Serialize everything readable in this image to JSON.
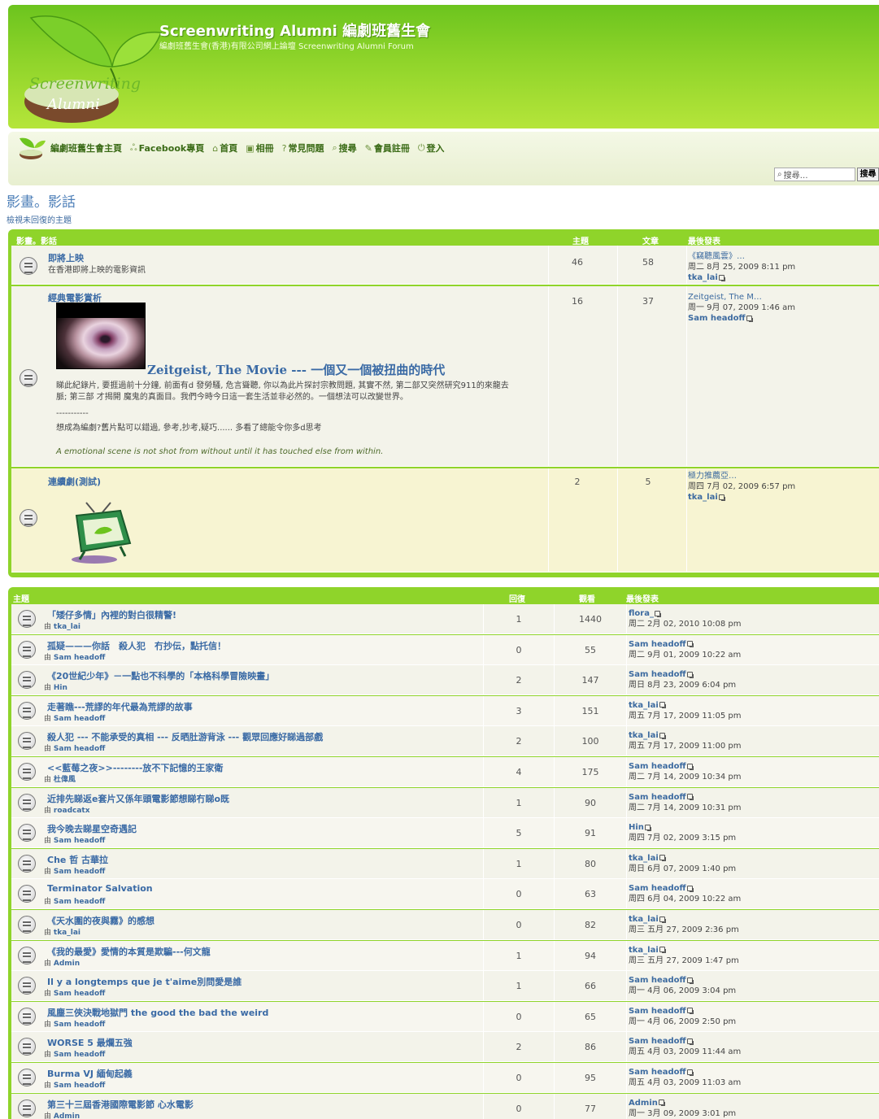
{
  "site": {
    "title": "Screenwriting Alumni 編劇班舊生會",
    "description": "編劇班舊生會(香港)有限公司網上論壇 Screenwriting Alumni Forum",
    "logo_text_1": "Screenwriting",
    "logo_text_2": "Alumni"
  },
  "nav": {
    "items": [
      {
        "icon": "home-icon",
        "label": "編劇班舊生會主頁"
      },
      {
        "icon": "facebook-icon",
        "label": "Facebook專頁"
      },
      {
        "icon": "house-icon",
        "label": "首頁"
      },
      {
        "icon": "album-icon",
        "label": "相冊"
      },
      {
        "icon": "faq-icon",
        "label": "常見問題"
      },
      {
        "icon": "search-icon",
        "label": "搜尋"
      },
      {
        "icon": "register-icon",
        "label": "會員註冊"
      },
      {
        "icon": "login-icon",
        "label": "登入"
      }
    ],
    "search_placeholder": "搜尋…",
    "search_button": "搜尋"
  },
  "page": {
    "title": "影畫。影話",
    "unanswered_link": "檢視未回復的主題"
  },
  "forums": {
    "header": {
      "name": "影畫。影話",
      "topics": "主題",
      "posts": "文章",
      "last_post": "最後發表"
    },
    "rows": [
      {
        "title": "即將上映",
        "desc": "在香港即將上映的電影資訊",
        "topics": "46",
        "posts": "58",
        "last_title": "《竊聽風雲》…",
        "last_date": "周二 8月 25, 2009 8:11 pm",
        "last_user": "tka_lai"
      },
      {
        "title": "經典電影賞析",
        "headline": "Zeitgeist, The Movie --- 一個又一個被扭曲的時代",
        "desc_1": "睇此紀錄片, 要捱過前十分鐘, 前面有d 發勞騷, 危言聳聽, 你以為此片探討宗教問題, 其實不然, 第二部又突然研究911的來龍去",
        "desc_2": "脈; 第三部 才揭開 魔鬼的真面目。我們今時今日這一套生活並非必然的。一個想法可以改變世界。",
        "separator": "-----------",
        "desc_3": "想成為編劇?舊片點可以錯過, 參考,抄考,疑巧...... 多看了總能令你多d思考",
        "quote": "A emotional scene is not shot from without until it has touched else from within.",
        "topics": "16",
        "posts": "37",
        "last_title": "Zeitgeist, The M…",
        "last_date": "周一 9月 07, 2009 1:46 am",
        "last_user": "Sam headoff"
      },
      {
        "title": "連續劇(測試)",
        "topics": "2",
        "posts": "5",
        "last_title": "極力推薦亞…",
        "last_date": "周四 7月 02, 2009 6:57 pm",
        "last_user": "tka_lai"
      }
    ]
  },
  "topics": {
    "header": {
      "topic": "主題",
      "replies": "回復",
      "views": "觀看",
      "last_post": "最後發表"
    },
    "by": "由",
    "rows": [
      {
        "title": "「矮仔多情」內裡的對白很精警!",
        "author": "tka_lai",
        "replies": "1",
        "views": "1440",
        "last_user": "flora_",
        "last_date": "周二 2月 02, 2010 10:08 pm"
      },
      {
        "title": "孤疑———你話　殺人犯　冇抄伝，點托信！",
        "author": "Sam headoff",
        "replies": "0",
        "views": "55",
        "last_user": "Sam headoff",
        "last_date": "周二 9月 01, 2009 10:22 am"
      },
      {
        "title": "《20世紀少年》－一點也不科學的「本格科學冒險映畫」",
        "author": "Hin",
        "replies": "2",
        "views": "147",
        "last_user": "Sam headoff",
        "last_date": "周日 8月 23, 2009 6:04 pm"
      },
      {
        "title": "走著瞧---荒謬的年代最為荒謬的故事",
        "author": "Sam headoff",
        "replies": "3",
        "views": "151",
        "last_user": "tka_lai",
        "last_date": "周五 7月 17, 2009 11:05 pm"
      },
      {
        "title": "殺人犯 --- 不能承受的真相 --- 反晒肚游背泳 --- 觀眾回應好睇過部戲",
        "author": "Sam headoff",
        "replies": "2",
        "views": "100",
        "last_user": "tka_lai",
        "last_date": "周五 7月 17, 2009 11:00 pm"
      },
      {
        "title": "<<藍莓之夜>>--------放不下記憶的王家衛",
        "author": "杜偉風",
        "replies": "4",
        "views": "175",
        "last_user": "Sam headoff",
        "last_date": "周二 7月 14, 2009 10:34 pm"
      },
      {
        "title": "近排先睇返e套片又係年頭電影節想睇冇睇o既",
        "author": "roadcatx",
        "replies": "1",
        "views": "90",
        "last_user": "Sam headoff",
        "last_date": "周二 7月 14, 2009 10:31 pm"
      },
      {
        "title": "我今晚去睇星空奇遇記",
        "author": "Sam headoff",
        "replies": "5",
        "views": "91",
        "last_user": "Hin",
        "last_date": "周四 7月 02, 2009 3:15 pm"
      },
      {
        "title": "Che 哲 古華拉",
        "author": "Sam headoff",
        "replies": "1",
        "views": "80",
        "last_user": "tka_lai",
        "last_date": "周日 6月 07, 2009 1:40 pm"
      },
      {
        "title": "Terminator Salvation",
        "author": "Sam headoff",
        "replies": "0",
        "views": "63",
        "last_user": "Sam headoff",
        "last_date": "周四 6月 04, 2009 10:22 am"
      },
      {
        "title": "《天水圍的夜與霧》的感想",
        "author": "tka_lai",
        "replies": "0",
        "views": "82",
        "last_user": "tka_lai",
        "last_date": "周三 五月 27, 2009 2:36 pm"
      },
      {
        "title": "《我的最愛》愛情的本質是欺騙---何文龍",
        "author": "Admin",
        "replies": "1",
        "views": "94",
        "last_user": "tka_lai",
        "last_date": "周三 五月 27, 2009 1:47 pm"
      },
      {
        "title": "Il y a longtemps que je t'aime別問愛是誰",
        "author": "Sam headoff",
        "replies": "1",
        "views": "66",
        "last_user": "Sam headoff",
        "last_date": "周一 4月 06, 2009 3:04 pm"
      },
      {
        "title": "風塵三俠決戰地獄門 the good the bad the weird",
        "author": "Sam headoff",
        "replies": "0",
        "views": "65",
        "last_user": "Sam headoff",
        "last_date": "周一 4月 06, 2009 2:50 pm"
      },
      {
        "title": "WORSE 5 最爛五強",
        "author": "Sam headoff",
        "replies": "2",
        "views": "86",
        "last_user": "Sam headoff",
        "last_date": "周五 4月 03, 2009 11:44 am"
      },
      {
        "title": "Burma VJ 緬甸起義",
        "author": "Sam headoff",
        "replies": "0",
        "views": "95",
        "last_user": "Sam headoff",
        "last_date": "周五 4月 03, 2009 11:03 am"
      },
      {
        "title": "第三十三屆香港國際電影節 心水電影",
        "author": "Admin",
        "replies": "0",
        "views": "77",
        "last_user": "Admin",
        "last_date": "周一 3月 09, 2009 3:01 pm"
      }
    ]
  },
  "colors": {
    "accent_green": "#8fd42a",
    "link_blue": "#3a6aa5",
    "row_bg": "#f3f3ea",
    "row_highlight": "#f7f4d2"
  }
}
